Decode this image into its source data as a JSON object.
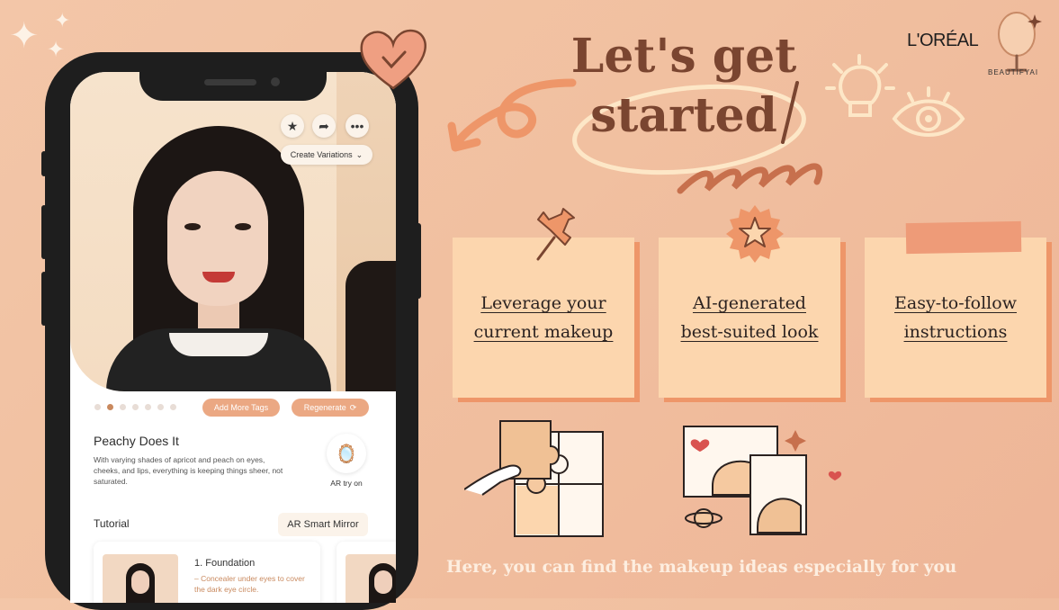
{
  "phone": {
    "create_variations": "Create Variations",
    "add_more_tags": "Add More Tags",
    "regenerate": "Regenerate",
    "look_title": "Peachy Does It",
    "look_description": "With varying shades of apricot and peach on eyes, cheeks, and lips, everything is keeping things sheer, not saturated.",
    "ar_try_on": "AR try on",
    "tutorial_title": "Tutorial",
    "ar_smart_mirror": "AR Smart Mirror",
    "step_title": "1. Foundation",
    "step_text": "– Concealer under eyes to cover the dark eye circle.",
    "carousel_dots": 7,
    "carousel_active": 1
  },
  "headline": {
    "line1": "Let's get",
    "line2": "started"
  },
  "brand": {
    "logo": "L'ORÉAL",
    "sub": "BEAUTIFYAI"
  },
  "features": [
    {
      "line1": "Leverage your",
      "line2": "current makeup"
    },
    {
      "line1": "AI-generated",
      "line2": "best-suited look"
    },
    {
      "line1": "Easy-to-follow",
      "line2": "instructions"
    }
  ],
  "footer": "Here, you can find the makeup ideas especially for you",
  "colors": {
    "accent": "#ee9669",
    "note": "#fcd6ae",
    "headline": "#7a4530",
    "brown": "#c9895e"
  }
}
